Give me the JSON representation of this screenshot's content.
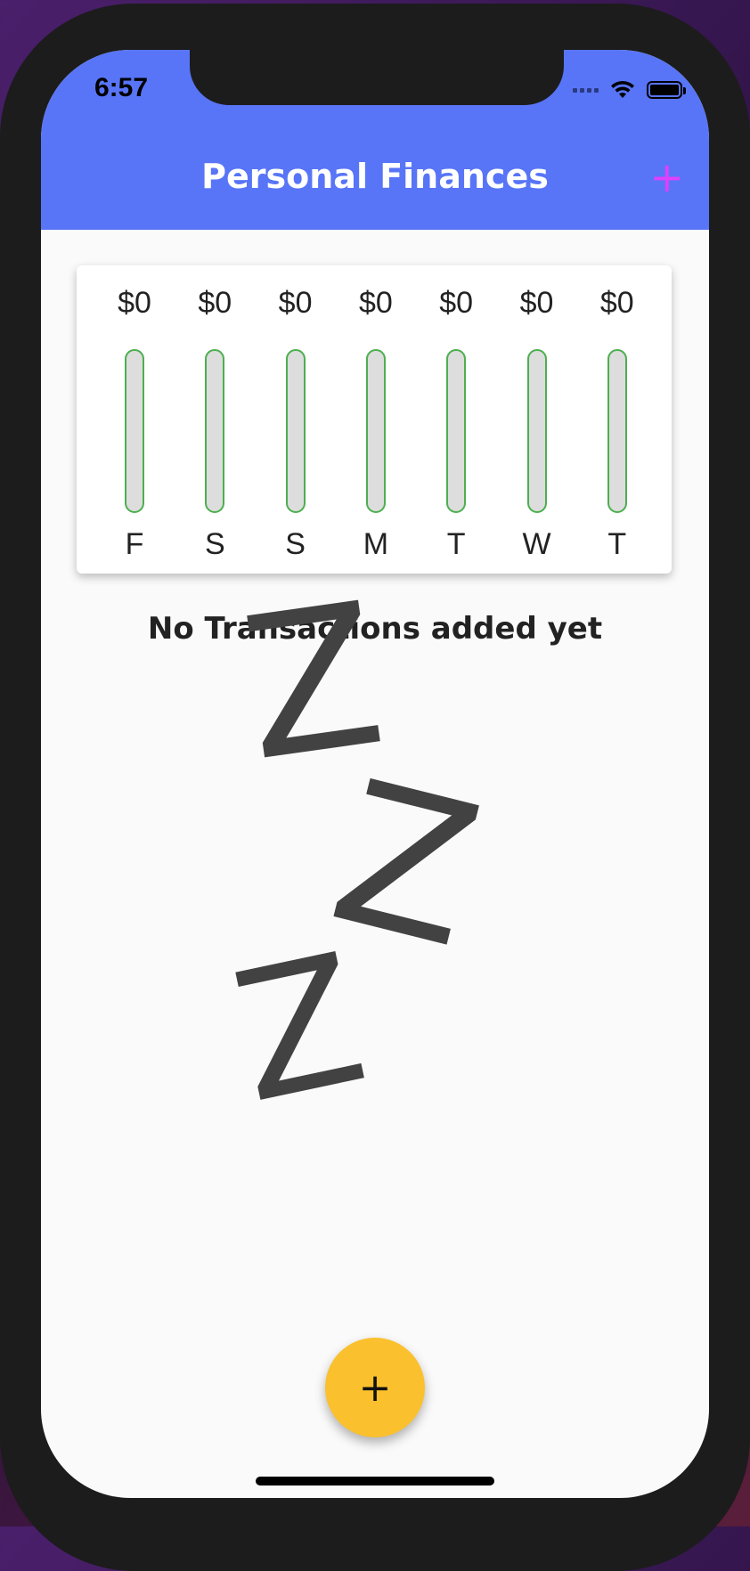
{
  "status_bar": {
    "time": "6:57"
  },
  "app_bar": {
    "title": "Personal Finances",
    "add_icon": "+"
  },
  "chart_data": {
    "type": "bar",
    "categories": [
      "F",
      "S",
      "S",
      "M",
      "T",
      "W",
      "T"
    ],
    "amount_labels": [
      "$0",
      "$0",
      "$0",
      "$0",
      "$0",
      "$0",
      "$0"
    ],
    "values": [
      0,
      0,
      0,
      0,
      0,
      0,
      0
    ],
    "fill_fractions": [
      0,
      0,
      0,
      0,
      0,
      0,
      0
    ],
    "colors": {
      "bar_border": "#4caf50",
      "bar_track": "#dddddd",
      "bar_fill": "#4caf50"
    }
  },
  "empty_state": {
    "message": "No Transactions added yet",
    "illustration": "sleeping-zzz-image",
    "letters": [
      "Z",
      "Z",
      "Z"
    ]
  },
  "fab": {
    "label": "+"
  },
  "colors": {
    "app_bar": "#5875f7",
    "fab": "#fbc02d",
    "accent_icon": "#e040fb"
  }
}
